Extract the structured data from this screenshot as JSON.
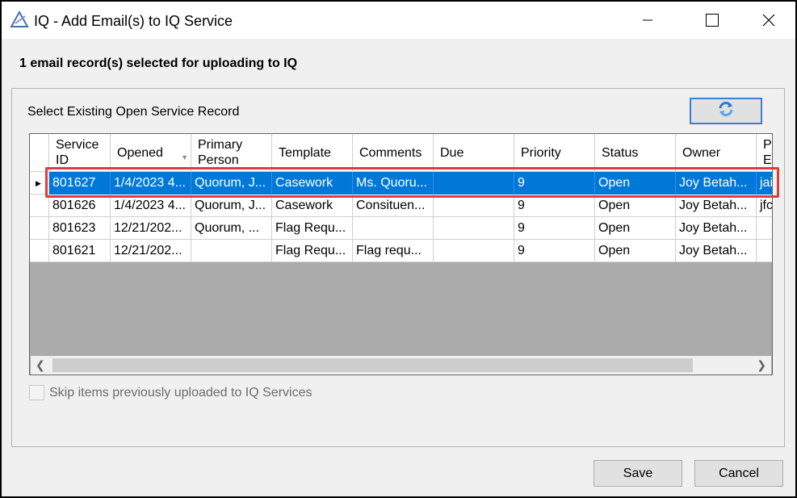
{
  "window": {
    "title": "IQ - Add Email(s) to IQ Service"
  },
  "header": {
    "selected_text": "1  email record(s) selected for uploading to IQ"
  },
  "group": {
    "label": "Select Existing Open Service Record",
    "refresh_icon": "refresh-icon"
  },
  "grid": {
    "columns": [
      {
        "line1": "Service",
        "line2": "ID"
      },
      {
        "line1": "Opened",
        "line2": ""
      },
      {
        "line1": "Primary",
        "line2": "Person"
      },
      {
        "line1": "Template",
        "line2": ""
      },
      {
        "line1": "Comments",
        "line2": ""
      },
      {
        "line1": "Due",
        "line2": ""
      },
      {
        "line1": "Priority",
        "line2": ""
      },
      {
        "line1": "Status",
        "line2": ""
      },
      {
        "line1": "Owner",
        "line2": ""
      },
      {
        "line1": "P",
        "line2": "E"
      }
    ],
    "rows": [
      {
        "cells": [
          "801627",
          "1/4/2023 4...",
          "Quorum, J...",
          "Casework",
          "Ms. Quoru...",
          "",
          "9",
          "Open",
          "Joy Betah...",
          "jai"
        ]
      },
      {
        "cells": [
          "801626",
          "1/4/2023 4...",
          "Quorum, J...",
          "Casework",
          "Consituen...",
          "",
          "9",
          "Open",
          "Joy Betah...",
          "jfc"
        ]
      },
      {
        "cells": [
          "801623",
          "12/21/202...",
          "Quorum, ...",
          "Flag Requ...",
          "",
          "",
          "9",
          "Open",
          "Joy Betah...",
          ""
        ]
      },
      {
        "cells": [
          "801621",
          "12/21/202...",
          "",
          "Flag Requ...",
          "Flag requ...",
          "",
          "9",
          "Open",
          "Joy Betah...",
          ""
        ]
      }
    ],
    "selected_row": 0
  },
  "skip": {
    "label": "Skip items previously uploaded to IQ Services",
    "checked": false,
    "enabled": false
  },
  "buttons": {
    "save": "Save",
    "cancel": "Cancel"
  },
  "colors": {
    "selection": "#0078d7",
    "highlight": "#e03c3c",
    "accent": "#3f7fcf"
  }
}
